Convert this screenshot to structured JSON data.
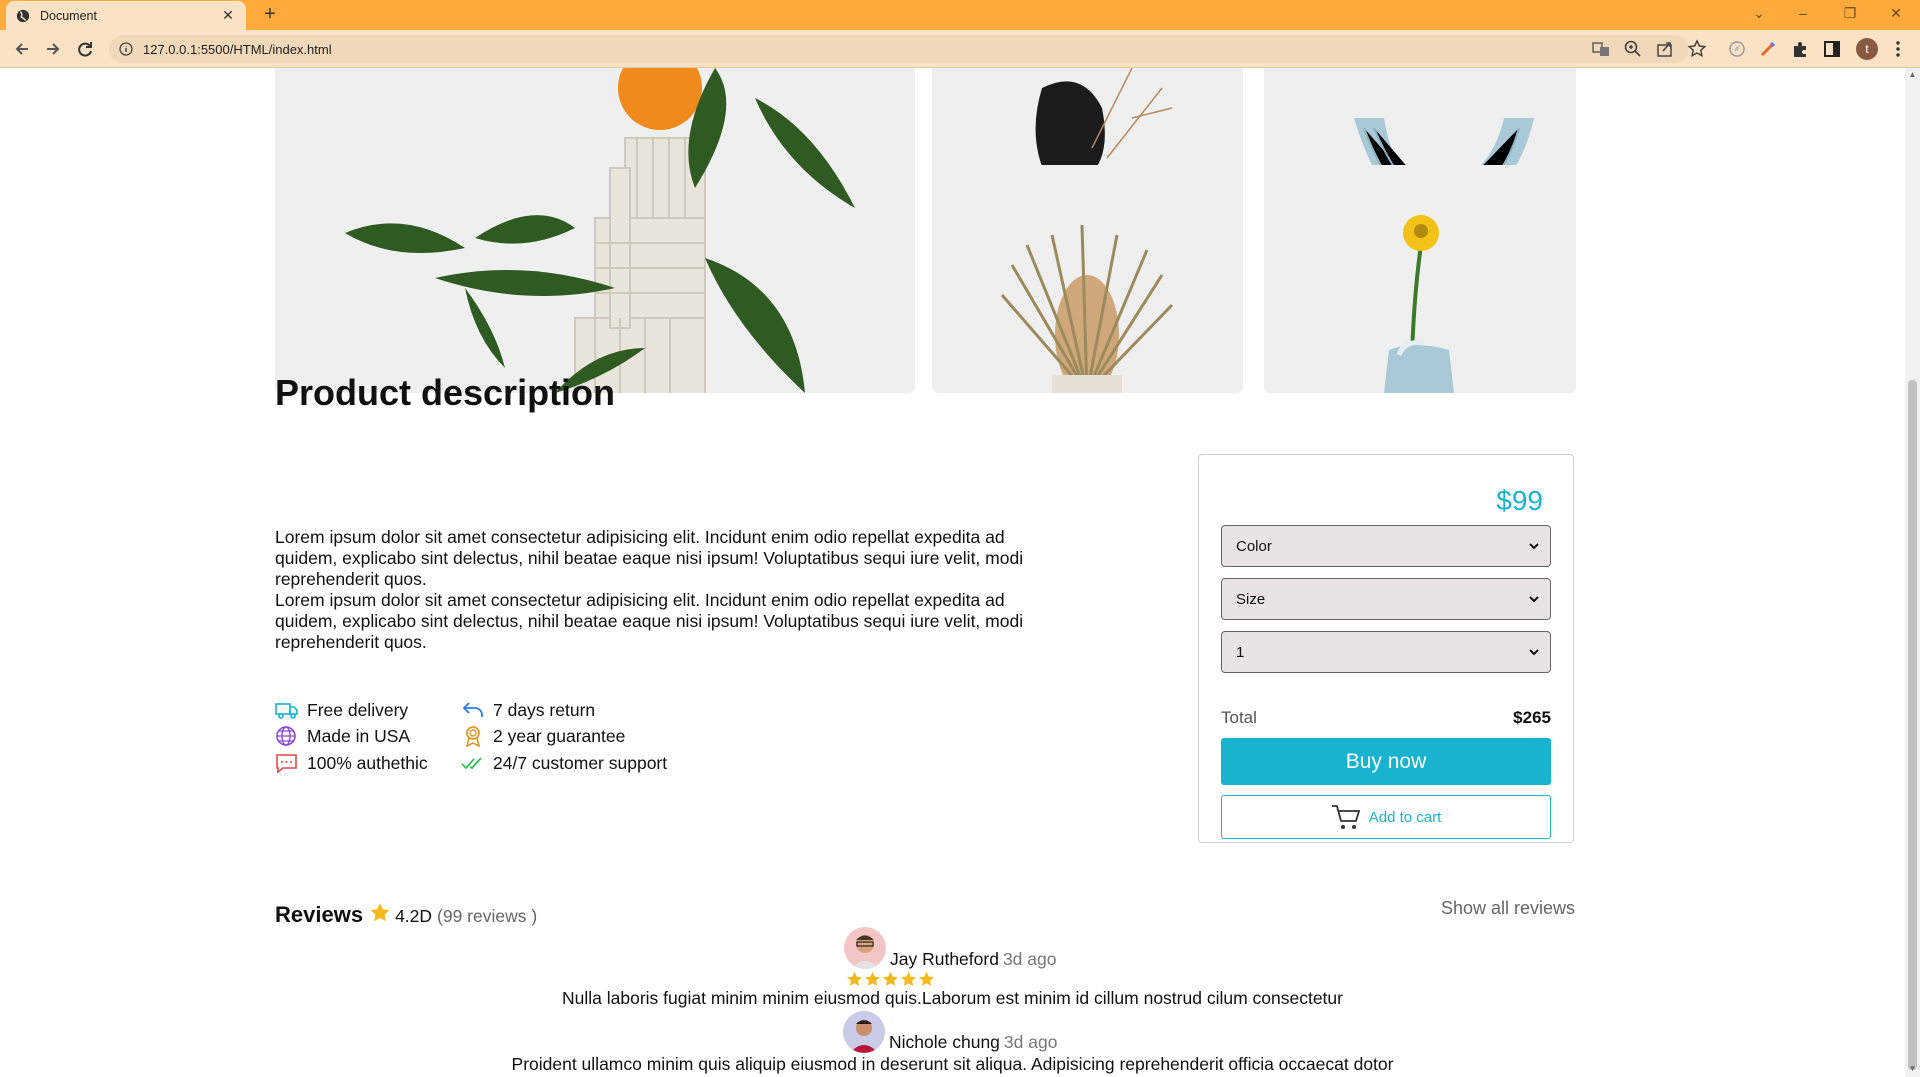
{
  "browser": {
    "tab_title": "Document",
    "new_tab_symbol": "+",
    "url": "127.0.0.1:5500/HTML/index.html",
    "profile_initial": "t",
    "accent_color": "#ffaa3b"
  },
  "product": {
    "section_title": "Product description",
    "paragraphs": [
      "Lorem ipsum dolor sit amet consectetur adipisicing elit. Incidunt enim odio repellat expedita ad quidem, explicabo sint delectus, nihil beatae eaque nisi ipsum! Voluptatibus sequi iure velit, modi reprehenderit quos.",
      "Lorem ipsum dolor sit amet consectetur adipisicing elit. Incidunt enim odio repellat expedita ad quidem, explicabo sint delectus, nihil beatae eaque nisi ipsum! Voluptatibus sequi iure velit, modi reprehenderit quos."
    ],
    "features": [
      {
        "label": "Free delivery",
        "icon": "truck-icon"
      },
      {
        "label": "Made in USA",
        "icon": "globe-icon"
      },
      {
        "label": "100% authethic",
        "icon": "chat-icon"
      },
      {
        "label": "7 days return",
        "icon": "return-arrow-icon"
      },
      {
        "label": "2 year guarantee",
        "icon": "award-icon"
      },
      {
        "label": "24/7 customer support",
        "icon": "double-check-icon"
      }
    ]
  },
  "purchase": {
    "price": "$99",
    "color_select": "Color",
    "size_select": "Size",
    "quantity_select": "1",
    "total_label": "Total",
    "total_value": "$265",
    "buy_now_label": "Buy now",
    "add_to_cart_label": "Add to cart",
    "accent_color": "#18b4cf"
  },
  "reviews": {
    "title": "Reviews",
    "rating": "4.2D",
    "count_text": "(99 reviews )",
    "show_all_label": "Show all reviews",
    "items": [
      {
        "name": "Jay Rutheford",
        "time": "3d ago",
        "stars": 5,
        "text": "Nulla laboris fugiat minim minim eiusmod quis.Laborum est minim id cillum nostrud cilum consectetur"
      },
      {
        "name": "Nichole chung",
        "time": "3d ago",
        "text": "Proident ullamco minim quis aliquip eiusmod in deserunt sit aliqua. Adipisicing reprehenderit officia occaecat dotor"
      }
    ]
  }
}
